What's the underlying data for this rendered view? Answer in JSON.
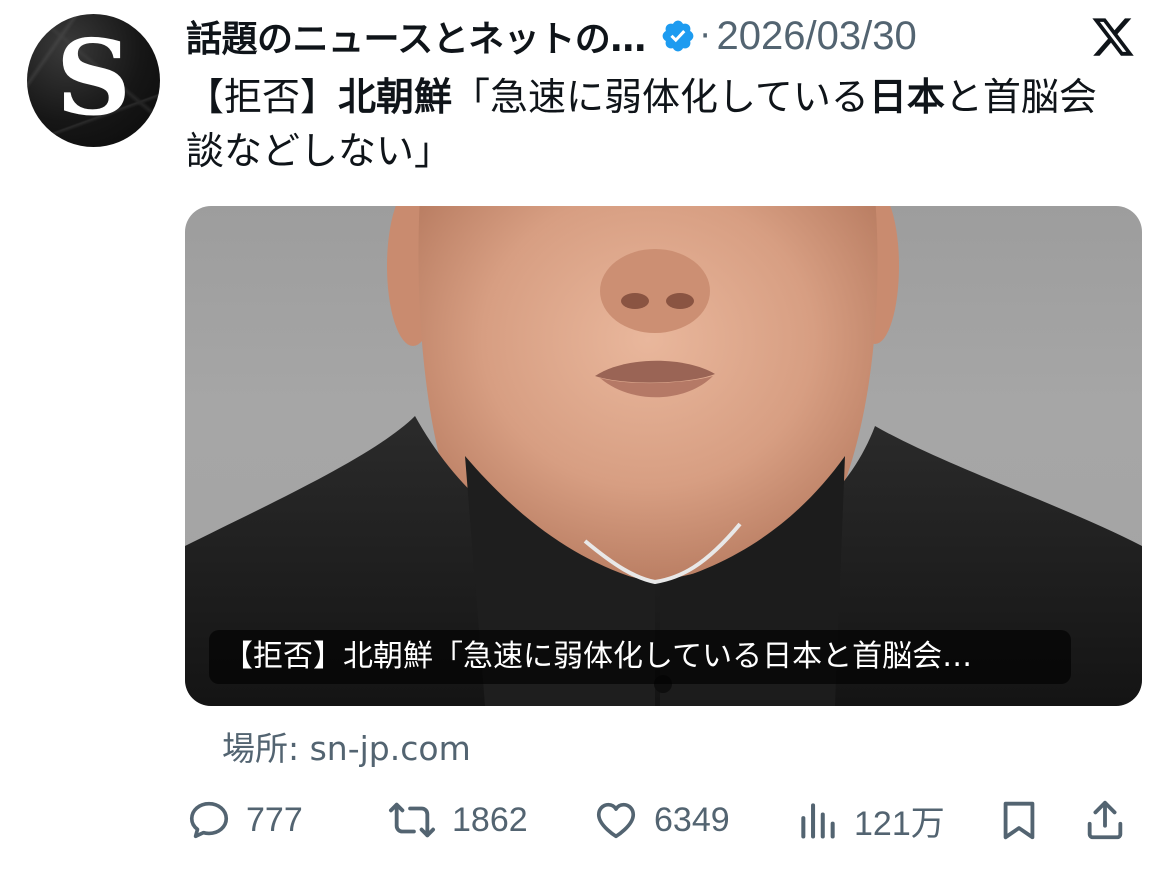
{
  "post": {
    "avatar_letter": "S",
    "author_name": "話題のニュースとネットの…",
    "separator": "·",
    "date": "2026/03/30",
    "text_parts": [
      {
        "text": "【拒否】",
        "bold": false
      },
      {
        "text": "北朝鮮",
        "bold": true
      },
      {
        "text": "「急速に弱体化している",
        "bold": false
      },
      {
        "text": "日本",
        "bold": true
      },
      {
        "text": "と首脳会談などしない」",
        "bold": false
      }
    ]
  },
  "card": {
    "caption": "【拒否】北朝鮮「急速に弱体化している日本と首脳会…"
  },
  "source": {
    "label": "場所: sn-jp.com"
  },
  "actions": {
    "replies": "777",
    "reposts": "1862",
    "likes": "6349",
    "views": "121万"
  },
  "icons": {
    "verified": "verified-badge-icon",
    "platform": "x-logo-icon",
    "reply": "reply-icon",
    "repost": "repost-icon",
    "like": "like-icon",
    "views": "views-icon",
    "bookmark": "bookmark-icon",
    "share": "share-icon"
  },
  "colors": {
    "verified_blue": "#1d9bf0",
    "secondary_text": "#536471",
    "primary_text": "#0f1419"
  }
}
